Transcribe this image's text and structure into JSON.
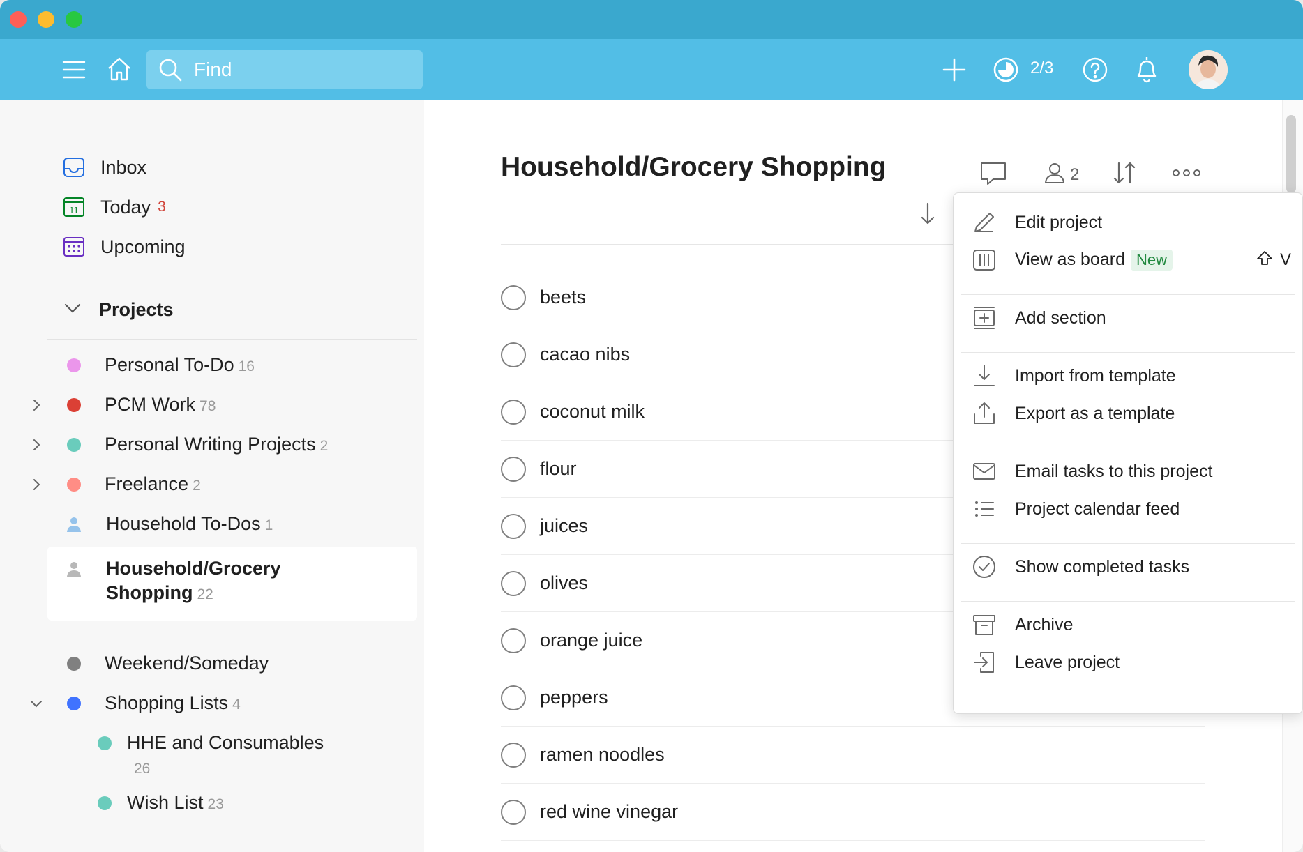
{
  "topbar": {
    "search_placeholder": "Find",
    "karma": "2/3"
  },
  "sidebar": {
    "nav": [
      {
        "label": "Inbox",
        "count": ""
      },
      {
        "label": "Today",
        "count": "3"
      },
      {
        "label": "Upcoming",
        "count": ""
      }
    ],
    "projects_heading": "Projects",
    "projects": [
      {
        "name": "Personal To-Do",
        "count": "16",
        "color": "#eb96eb"
      },
      {
        "name": "PCM Work",
        "count": "78",
        "color": "#db4035"
      },
      {
        "name": "Personal Writing Projects",
        "count": "2",
        "color": "#6accbc"
      },
      {
        "name": "Freelance",
        "count": "2",
        "color": "#ff8d85"
      },
      {
        "name": "Household To-Dos",
        "count": "1",
        "color": "#96c3eb"
      },
      {
        "name_line1": "Household/Grocery",
        "name_line2": "Shopping",
        "count": "22",
        "color": "#b8b8b8"
      },
      {
        "name": "Weekend/Someday",
        "count": "",
        "color": "#808080"
      },
      {
        "name": "Shopping Lists",
        "count": "4",
        "color": "#4073ff"
      },
      {
        "name": "HHE and Consumables",
        "count": "26",
        "color": "#6accbc"
      },
      {
        "name": "Wish List",
        "count": "23",
        "color": "#6accbc"
      }
    ]
  },
  "main": {
    "title": "Household/Grocery Shopping",
    "collaborators": "2",
    "tasks": [
      "beets",
      "cacao nibs",
      "coconut milk",
      "flour",
      "juices",
      "olives",
      "orange juice",
      "peppers",
      "ramen noodles",
      "red wine vinegar"
    ]
  },
  "menu": {
    "items": [
      {
        "label": "Edit project",
        "icon": "pencil-icon"
      },
      {
        "label": "View as board",
        "badge": "New",
        "shortcut": "V",
        "icon": "board-icon"
      },
      {
        "label": "Add section",
        "icon": "add-section-icon"
      },
      {
        "label": "Import from template",
        "icon": "import-icon"
      },
      {
        "label": "Export as a template",
        "icon": "export-icon"
      },
      {
        "label": "Email tasks to this project",
        "icon": "mail-icon"
      },
      {
        "label": "Project calendar feed",
        "icon": "list-icon"
      },
      {
        "label": "Show completed tasks",
        "icon": "check-circle-icon"
      },
      {
        "label": "Archive",
        "icon": "archive-icon"
      },
      {
        "label": "Leave project",
        "icon": "leave-icon"
      }
    ]
  },
  "colors": {
    "titlebar": "#3aa8ce",
    "topbar": "#52bee6",
    "accent_red": "#d1453b",
    "badge_green": "#21893f"
  }
}
